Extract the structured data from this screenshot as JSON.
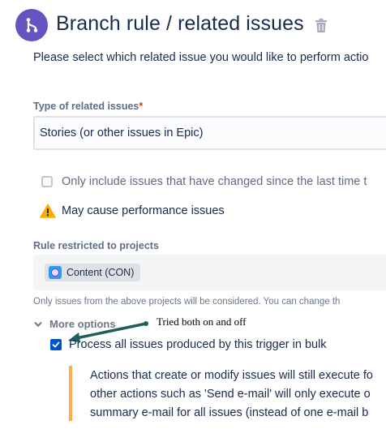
{
  "header": {
    "title": "Branch rule / related issues",
    "icon": "branch-icon",
    "icon_color": "#6554C0",
    "delete_icon": "trash-icon"
  },
  "instructions": "Please select which related issue you would like to perform actio",
  "related_type": {
    "label": "Type of related issues",
    "required_mark": "*",
    "selected_value": "Stories (or other issues in Epic)"
  },
  "changed_only": {
    "label": "Only include issues that have changed since the last time t",
    "checked": false
  },
  "warning": {
    "icon": "warning-icon",
    "text": "May cause performance issues"
  },
  "projects": {
    "label": "Rule restricted to projects",
    "chips": [
      {
        "label": "Content (CON)",
        "icon": "project-avatar-icon"
      }
    ],
    "hint": "Only issues from the above projects will be considered. You can change th"
  },
  "more_options": {
    "label": "More options",
    "expanded": true
  },
  "annotation": {
    "text": "Tried both on and off",
    "arrow_color": "#1F5F5B"
  },
  "bulk": {
    "label": "Process all issues produced by this trigger in bulk",
    "checked": true,
    "description_lines": [
      "Actions that create or modify issues will still execute fo",
      "other actions such as 'Send e-mail' will only execute o",
      "summary e-mail for all issues (instead of one e-mail b"
    ],
    "border_color": "#FFAB4A"
  }
}
